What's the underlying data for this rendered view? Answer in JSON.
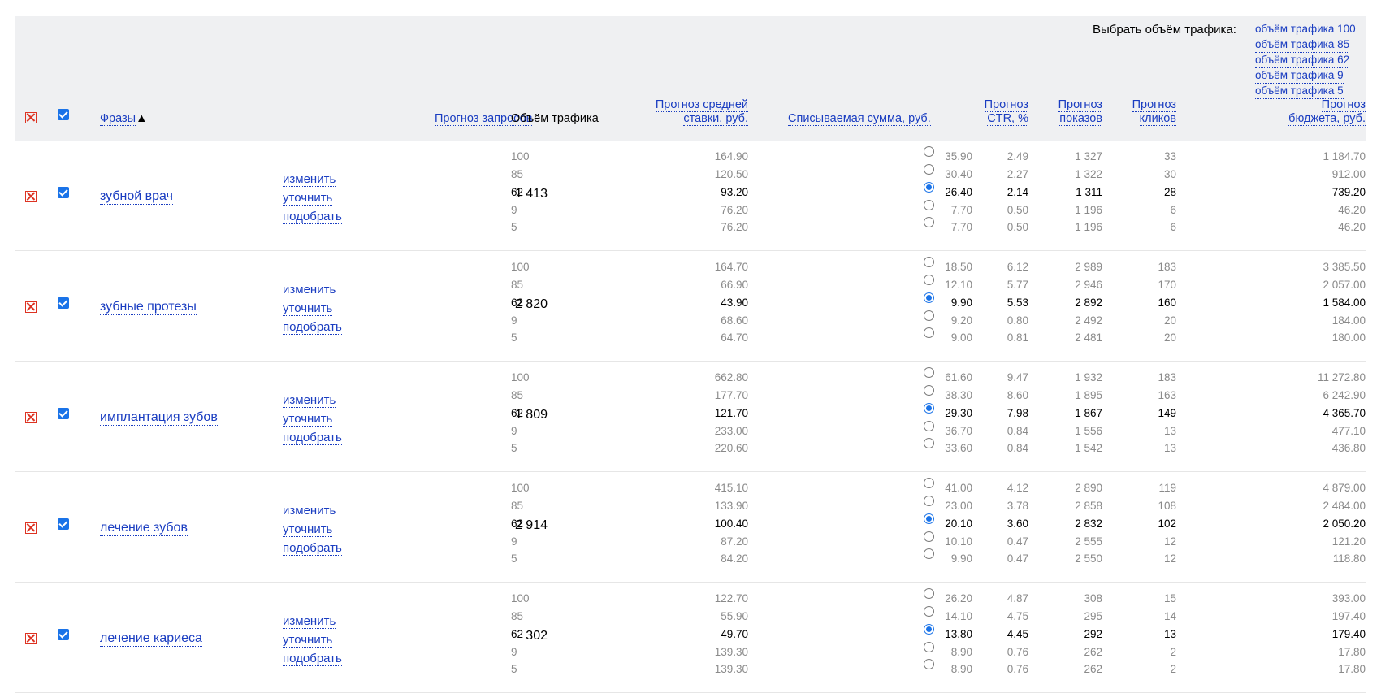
{
  "header": {
    "traffic_select_label": "Выбрать объём трафика:",
    "traffic_links": [
      "объём трафика 100",
      "объём трафика 85",
      "объём трафика 62",
      "объём трафика 9",
      "объём трафика 5"
    ],
    "col_phrases": "Фразы",
    "col_phrases_sort": "▲",
    "col_queries": "Прогноз запросов",
    "col_traffic": "Объём трафика",
    "col_bid_1": "Прогноз средней",
    "col_bid_2": "ставки, руб.",
    "col_charge": "Списываемая сумма, руб.",
    "col_ctr_1": "Прогноз",
    "col_ctr_2": "CTR, %",
    "col_shows_1": "Прогноз",
    "col_shows_2": "показов",
    "col_clicks_1": "Прогноз",
    "col_clicks_2": "кликов",
    "col_budget_1": "Прогноз",
    "col_budget_2": "бюджета, руб."
  },
  "actions": {
    "edit": "изменить",
    "refine": "уточнить",
    "pick": "подобрать"
  },
  "groups": [
    {
      "phrase": "зубной врач",
      "queries": "1 413",
      "rows": [
        {
          "traffic": "100",
          "bid": "164.90",
          "charge": "35.90",
          "ctr": "2.49",
          "shows": "1 327",
          "clicks": "33",
          "budget": "1 184.70"
        },
        {
          "traffic": "85",
          "bid": "120.50",
          "charge": "30.40",
          "ctr": "2.27",
          "shows": "1 322",
          "clicks": "30",
          "budget": "912.00"
        },
        {
          "traffic": "62",
          "bid": "93.20",
          "charge": "26.40",
          "ctr": "2.14",
          "shows": "1 311",
          "clicks": "28",
          "budget": "739.20"
        },
        {
          "traffic": "9",
          "bid": "76.20",
          "charge": "7.70",
          "ctr": "0.50",
          "shows": "1 196",
          "clicks": "6",
          "budget": "46.20"
        },
        {
          "traffic": "5",
          "bid": "76.20",
          "charge": "7.70",
          "ctr": "0.50",
          "shows": "1 196",
          "clicks": "6",
          "budget": "46.20"
        }
      ]
    },
    {
      "phrase": "зубные протезы",
      "queries": "2 820",
      "rows": [
        {
          "traffic": "100",
          "bid": "164.70",
          "charge": "18.50",
          "ctr": "6.12",
          "shows": "2 989",
          "clicks": "183",
          "budget": "3 385.50"
        },
        {
          "traffic": "85",
          "bid": "66.90",
          "charge": "12.10",
          "ctr": "5.77",
          "shows": "2 946",
          "clicks": "170",
          "budget": "2 057.00"
        },
        {
          "traffic": "62",
          "bid": "43.90",
          "charge": "9.90",
          "ctr": "5.53",
          "shows": "2 892",
          "clicks": "160",
          "budget": "1 584.00"
        },
        {
          "traffic": "9",
          "bid": "68.60",
          "charge": "9.20",
          "ctr": "0.80",
          "shows": "2 492",
          "clicks": "20",
          "budget": "184.00"
        },
        {
          "traffic": "5",
          "bid": "64.70",
          "charge": "9.00",
          "ctr": "0.81",
          "shows": "2 481",
          "clicks": "20",
          "budget": "180.00"
        }
      ]
    },
    {
      "phrase": "имплантация зубов",
      "queries": "1 809",
      "rows": [
        {
          "traffic": "100",
          "bid": "662.80",
          "charge": "61.60",
          "ctr": "9.47",
          "shows": "1 932",
          "clicks": "183",
          "budget": "11 272.80"
        },
        {
          "traffic": "85",
          "bid": "177.70",
          "charge": "38.30",
          "ctr": "8.60",
          "shows": "1 895",
          "clicks": "163",
          "budget": "6 242.90"
        },
        {
          "traffic": "62",
          "bid": "121.70",
          "charge": "29.30",
          "ctr": "7.98",
          "shows": "1 867",
          "clicks": "149",
          "budget": "4 365.70"
        },
        {
          "traffic": "9",
          "bid": "233.00",
          "charge": "36.70",
          "ctr": "0.84",
          "shows": "1 556",
          "clicks": "13",
          "budget": "477.10"
        },
        {
          "traffic": "5",
          "bid": "220.60",
          "charge": "33.60",
          "ctr": "0.84",
          "shows": "1 542",
          "clicks": "13",
          "budget": "436.80"
        }
      ]
    },
    {
      "phrase": "лечение зубов",
      "queries": "2 914",
      "rows": [
        {
          "traffic": "100",
          "bid": "415.10",
          "charge": "41.00",
          "ctr": "4.12",
          "shows": "2 890",
          "clicks": "119",
          "budget": "4 879.00"
        },
        {
          "traffic": "85",
          "bid": "133.90",
          "charge": "23.00",
          "ctr": "3.78",
          "shows": "2 858",
          "clicks": "108",
          "budget": "2 484.00"
        },
        {
          "traffic": "62",
          "bid": "100.40",
          "charge": "20.10",
          "ctr": "3.60",
          "shows": "2 832",
          "clicks": "102",
          "budget": "2 050.20"
        },
        {
          "traffic": "9",
          "bid": "87.20",
          "charge": "10.10",
          "ctr": "0.47",
          "shows": "2 555",
          "clicks": "12",
          "budget": "121.20"
        },
        {
          "traffic": "5",
          "bid": "84.20",
          "charge": "9.90",
          "ctr": "0.47",
          "shows": "2 550",
          "clicks": "12",
          "budget": "118.80"
        }
      ]
    },
    {
      "phrase": "лечение кариеса",
      "queries": "302",
      "rows": [
        {
          "traffic": "100",
          "bid": "122.70",
          "charge": "26.20",
          "ctr": "4.87",
          "shows": "308",
          "clicks": "15",
          "budget": "393.00"
        },
        {
          "traffic": "85",
          "bid": "55.90",
          "charge": "14.10",
          "ctr": "4.75",
          "shows": "295",
          "clicks": "14",
          "budget": "197.40"
        },
        {
          "traffic": "62",
          "bid": "49.70",
          "charge": "13.80",
          "ctr": "4.45",
          "shows": "292",
          "clicks": "13",
          "budget": "179.40"
        },
        {
          "traffic": "9",
          "bid": "139.30",
          "charge": "8.90",
          "ctr": "0.76",
          "shows": "262",
          "clicks": "2",
          "budget": "17.80"
        },
        {
          "traffic": "5",
          "bid": "139.30",
          "charge": "8.90",
          "ctr": "0.76",
          "shows": "262",
          "clicks": "2",
          "budget": "17.80"
        }
      ]
    }
  ],
  "selected_traffic": "62",
  "colors": {
    "link": "#1a3dc1",
    "header_bg": "#eff0f2",
    "remove_icon": "#dd3322",
    "checkbox": "#1a73e8",
    "muted_text": "#8a8a8a"
  }
}
